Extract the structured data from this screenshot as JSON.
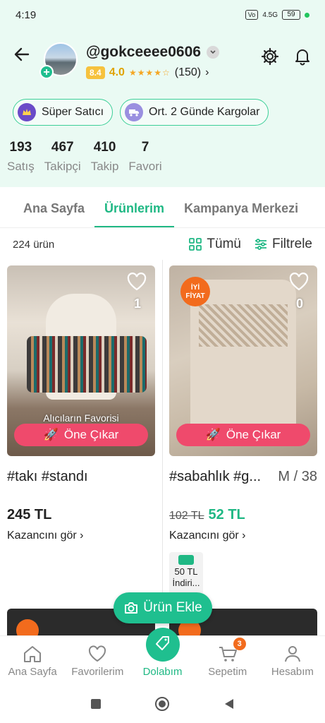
{
  "status_bar": {
    "time": "4:19",
    "network": "4.5G",
    "battery": "59"
  },
  "profile": {
    "username": "@gokceeee0606",
    "score": "8.4",
    "rating": "4.0",
    "stars": "★★★★☆",
    "review_count": "(150)",
    "badges": [
      {
        "label": "Süper Satıcı",
        "icon": "crown-icon"
      },
      {
        "label": "Ort. 2 Günde Kargolar",
        "icon": "truck-icon"
      }
    ],
    "stats": [
      {
        "value": "193",
        "label": "Satış"
      },
      {
        "value": "467",
        "label": "Takipçi"
      },
      {
        "value": "410",
        "label": "Takip"
      },
      {
        "value": "7",
        "label": "Favori"
      }
    ]
  },
  "tabs": [
    {
      "label": "Ana Sayfa",
      "active": false
    },
    {
      "label": "Ürünlerim",
      "active": true
    },
    {
      "label": "Kampanya Merkezi",
      "active": false
    }
  ],
  "filter_bar": {
    "product_count": "224 ürün",
    "view_label": "Tümü",
    "filter_label": "Filtrele"
  },
  "products": [
    {
      "title": "#takı #standı",
      "size": "",
      "price": "245 TL",
      "old_price": "",
      "likes": "1",
      "favorite_label": "Alıcıların Favorisi",
      "promote_label": "Öne Çıkar",
      "earn_label": "Kazancını gör ›"
    },
    {
      "title": "#sabahlık #g...",
      "size": "M / 38",
      "price": "52 TL",
      "old_price": "102 TL",
      "likes": "0",
      "badge_line1": "İYİ",
      "badge_line2": "FİYAT",
      "promote_label": "Öne Çıkar",
      "earn_label": "Kazancını gör ›",
      "coupon_text": "50 TL İndiri..."
    }
  ],
  "add_product_label": "Ürün Ekle",
  "bottom_nav": [
    {
      "label": "Ana Sayfa",
      "icon": "home-icon"
    },
    {
      "label": "Favorilerim",
      "icon": "heart-icon"
    },
    {
      "label": "Dolabım",
      "icon": "tag-icon",
      "active": true
    },
    {
      "label": "Sepetim",
      "icon": "cart-icon",
      "badge": "3"
    },
    {
      "label": "Hesabım",
      "icon": "user-icon"
    }
  ],
  "colors": {
    "accent": "#1fb884",
    "promote": "#ef4a6c",
    "header_bg": "#eafaf3"
  }
}
